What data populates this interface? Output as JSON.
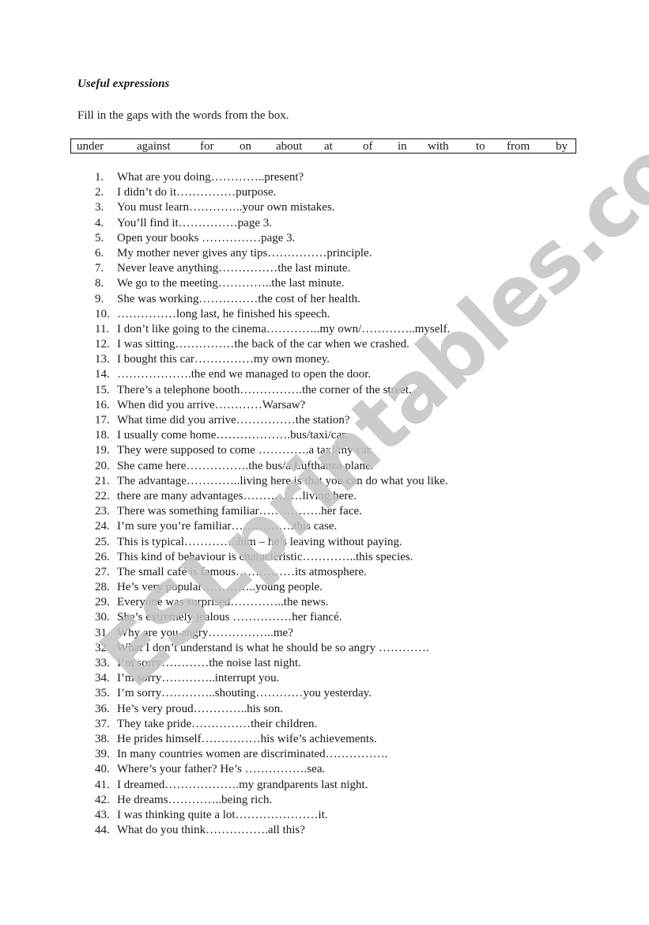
{
  "worksheet": {
    "title": "Useful expressions",
    "instruction": "Fill in the gaps with the words from the box.",
    "word_box": [
      "under",
      "against",
      "for",
      "on",
      "about",
      "at",
      "of",
      "in",
      "with",
      "to",
      "from",
      "by"
    ],
    "exercises": [
      {
        "num": "1.",
        "text": "What are you doing…………..present?"
      },
      {
        "num": "2.",
        "text": "I didn’t do it……………purpose."
      },
      {
        "num": "3.",
        "text": "You must learn…………..your own mistakes."
      },
      {
        "num": "4.",
        "text": "You’ll find it……………page 3."
      },
      {
        "num": "5.",
        "text": "Open your books ……………page 3."
      },
      {
        "num": "6.",
        "text": "My mother never gives any tips……………principle."
      },
      {
        "num": "7.",
        "text": "Never leave anything……………the last minute."
      },
      {
        "num": "8.",
        "text": "We go to the meeting…………..the last minute."
      },
      {
        "num": "9.",
        "text": "She was working……………the cost of her health."
      },
      {
        "num": "10.",
        "text": "……………long last, he finished his speech."
      },
      {
        "num": "11.",
        "text": "I don’t like going to the cinema…………..my own/…………..myself."
      },
      {
        "num": "12.",
        "text": "I was sitting……………the back of the car when we crashed."
      },
      {
        "num": "13.",
        "text": "I bought this car……………my own money."
      },
      {
        "num": "14.",
        "text": "……………….the end we managed to open the door."
      },
      {
        "num": "15.",
        "text": "There’s a telephone booth…………….the corner of the street."
      },
      {
        "num": "16.",
        "text": "When did you arrive…………Warsaw?"
      },
      {
        "num": "17.",
        "text": "What time did you arrive……………the station?"
      },
      {
        "num": "18.",
        "text": "I usually come home……………….bus/taxi/car."
      },
      {
        "num": "19.",
        "text": "They were supposed to come ………….a taxi/my car."
      },
      {
        "num": "20.",
        "text": "She came here…………….the bus/a Lufthanza plane."
      },
      {
        "num": "21.",
        "text": "The advantage…………..living here is that you can do what you like."
      },
      {
        "num": "22.",
        "text": "there are many advantages……………living here."
      },
      {
        "num": "23.",
        "text": "There was something familiar…………….her face."
      },
      {
        "num": "24.",
        "text": "I’m sure you’re familiar…………….this case."
      },
      {
        "num": "25.",
        "text": "This is typical…………..him – he’s leaving without paying."
      },
      {
        "num": "26.",
        "text": "This kind of behaviour is characteristic…………..this species."
      },
      {
        "num": "27.",
        "text": "The small café is famous……………its atmosphere."
      },
      {
        "num": "28.",
        "text": "He’s very popular…………..young people."
      },
      {
        "num": "29.",
        "text": "Everyone was surprised…………..the news."
      },
      {
        "num": "30.",
        "text": "She’s extremely jealous ……………her fiancé."
      },
      {
        "num": "31.",
        "text": "Why are you angry……………..me?"
      },
      {
        "num": "32.",
        "text": "What I don’t understand is what he should be so angry …………."
      },
      {
        "num": "33.",
        "text": "I’m sorry…………the noise last night."
      },
      {
        "num": "34.",
        "text": "I’m sorry…………..interrupt you."
      },
      {
        "num": "35.",
        "text": "I’m sorry…………..shouting…………you yesterday."
      },
      {
        "num": "36.",
        "text": "He’s very proud…………..his son."
      },
      {
        "num": "37.",
        "text": "They take pride……………their children."
      },
      {
        "num": "38.",
        "text": "He prides himself……………his wife’s achievements."
      },
      {
        "num": "39.",
        "text": "In many countries women are discriminated……………."
      },
      {
        "num": "40.",
        "text": "Where’s your father? He’s …………….sea."
      },
      {
        "num": "41.",
        "text": "I dreamed……………….my grandparents last night."
      },
      {
        "num": "42.",
        "text": "He dreams…………..being rich."
      },
      {
        "num": "43.",
        "text": "I was thinking quite a lot…………………it."
      },
      {
        "num": "44.",
        "text": "What do you think…………….all this?"
      }
    ]
  },
  "watermark": {
    "text": "ESLprintables.com",
    "color": "#c4c4c4"
  }
}
